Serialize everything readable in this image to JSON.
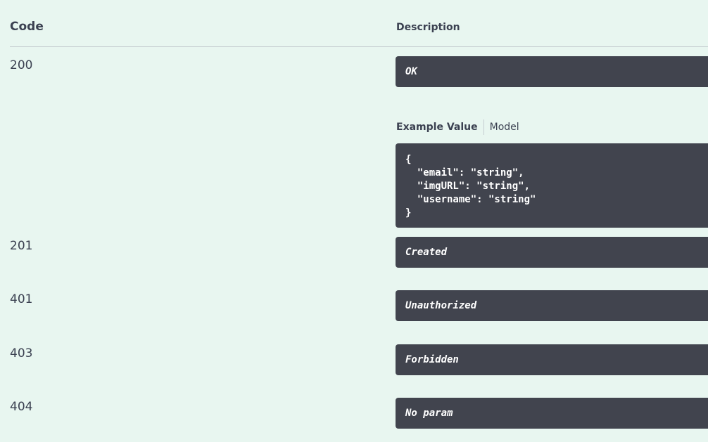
{
  "header": {
    "code_label": "Code",
    "description_label": "Description"
  },
  "responses": [
    {
      "code": "200",
      "description": "OK"
    },
    {
      "code": "201",
      "description": "Created"
    },
    {
      "code": "401",
      "description": "Unauthorized"
    },
    {
      "code": "403",
      "description": "Forbidden"
    },
    {
      "code": "404",
      "description": "No param"
    }
  ],
  "example": {
    "tab_example_label": "Example Value",
    "tab_model_label": "Model",
    "body": "{\n  \"email\": \"string\",\n  \"imgURL\": \"string\",\n  \"username\": \"string\"\n}"
  },
  "colors": {
    "background": "#e8f6f0",
    "box": "#41444e",
    "text": "#3b4151"
  }
}
